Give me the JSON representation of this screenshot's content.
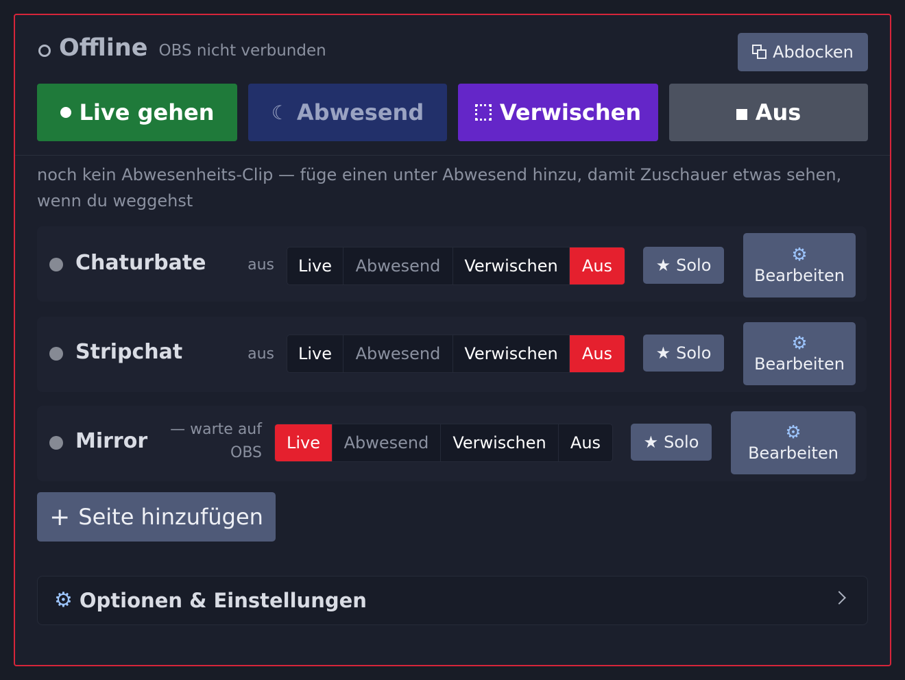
{
  "header": {
    "status_title": "Offline",
    "status_subtitle": "OBS nicht verbunden",
    "undock_label": "Abdocken",
    "undock_icon": "undock-icon"
  },
  "modes": {
    "live": {
      "label": "Live gehen",
      "icon": "dot-icon"
    },
    "away": {
      "label": "Abwesend",
      "icon": "moon-icon"
    },
    "blur": {
      "label": "Verwischen",
      "icon": "blur-icon"
    },
    "off": {
      "label": "Aus",
      "icon": "stop-icon"
    }
  },
  "hint": "noch kein Abwesenheits-Clip — füge einen unter Abwesend hinzu, damit Zuschauer etwas sehen, wenn du weggehst",
  "sources": [
    {
      "name": "Chaturbate",
      "state": "aus",
      "segments": [
        "Live",
        "Abwesend",
        "Verwischen",
        "Aus"
      ],
      "active_segment": "Aus",
      "solo_label": "Solo",
      "edit_label": "Bearbeiten"
    },
    {
      "name": "Stripchat",
      "state": "aus",
      "segments": [
        "Live",
        "Abwesend",
        "Verwischen",
        "Aus"
      ],
      "active_segment": "Aus",
      "solo_label": "Solo",
      "edit_label": "Bearbeiten"
    },
    {
      "name": "Mirror",
      "state_line1": "— warte auf",
      "state_line2": "OBS",
      "segments": [
        "Live",
        "Abwesend",
        "Verwischen",
        "Aus"
      ],
      "active_segment": "Live",
      "solo_label": "Solo",
      "edit_label": "Bearbeiten"
    }
  ],
  "add_page_label": "Seite hinzufügen",
  "options_label": "Optionen & Einstellungen",
  "colors": {
    "border_accent": "#d6253a",
    "live_green": "#1f7a3a",
    "away_blue": "#22306a",
    "blur_purple": "#6426c8",
    "active_red": "#e5202e",
    "button_slate": "#4f5a78"
  }
}
